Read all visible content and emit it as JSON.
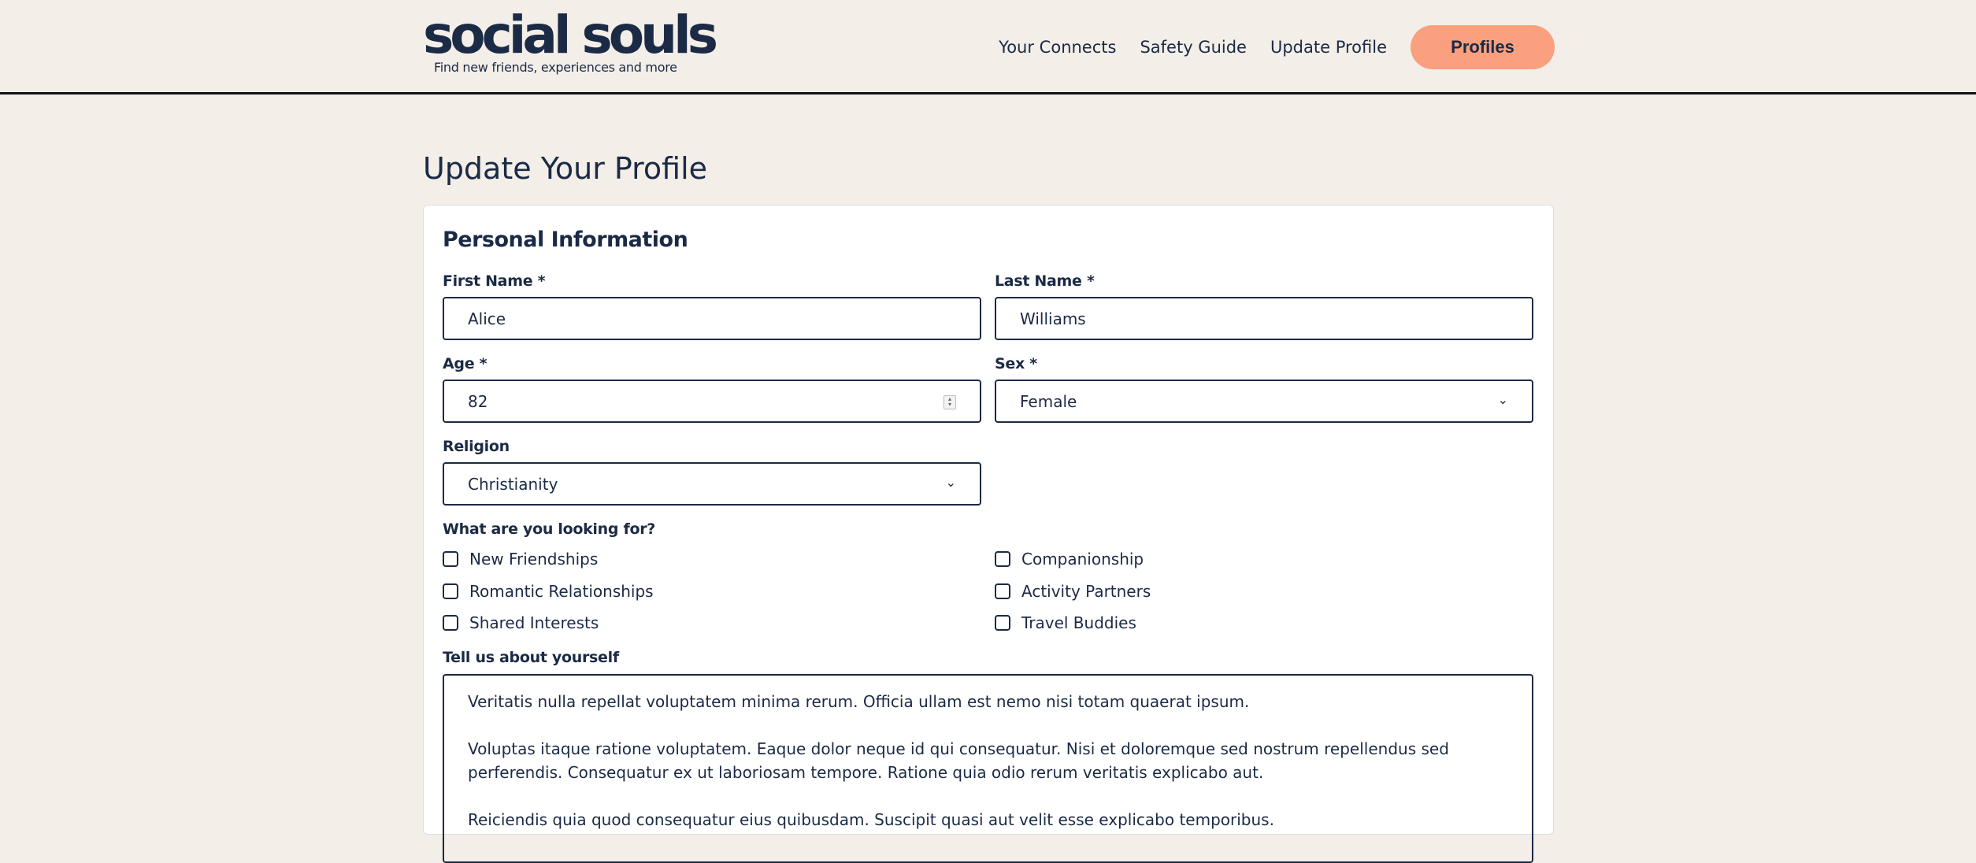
{
  "header": {
    "logo_text": "social souls",
    "tagline": "Find new friends, experiences and more",
    "nav": [
      "Your Connects",
      "Safety Guide",
      "Update Profile"
    ],
    "cta_label": "Profiles"
  },
  "page": {
    "title": "Update Your Profile"
  },
  "form": {
    "section_title": "Personal Information",
    "first_name": {
      "label": "First Name *",
      "value": "Alice"
    },
    "last_name": {
      "label": "Last Name *",
      "value": "Williams"
    },
    "age": {
      "label": "Age *",
      "value": "82"
    },
    "sex": {
      "label": "Sex *",
      "value": "Female"
    },
    "religion": {
      "label": "Religion",
      "value": "Christianity"
    },
    "looking_for": {
      "label": "What are you looking for?",
      "options": [
        "New Friendships",
        "Companionship",
        "Romantic Relationships",
        "Activity Partners",
        "Shared Interests",
        "Travel Buddies"
      ]
    },
    "about": {
      "label": "Tell us about yourself",
      "paragraphs": [
        "Veritatis nulla repellat voluptatem minima rerum. Officia ullam est nemo nisi totam quaerat ipsum.",
        "Voluptas itaque ratione voluptatem. Eaque dolor neque id qui consequatur. Nisi et doloremque sed nostrum repellendus sed perferendis. Consequatur ex ut laboriosam tempore. Ratione quia odio rerum veritatis explicabo aut.",
        "Reiciendis quia quod consequatur eius quibusdam. Suscipit quasi aut velit esse explicabo temporibus."
      ]
    }
  }
}
